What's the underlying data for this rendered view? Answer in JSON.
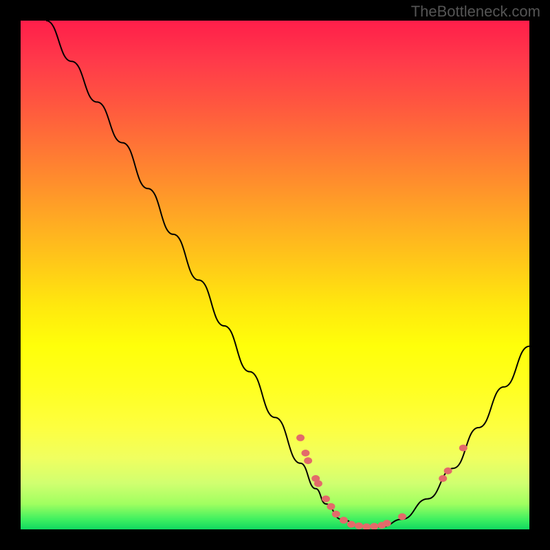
{
  "watermark": "TheBottleneck.com",
  "chart_data": {
    "type": "line",
    "title": "",
    "xlabel": "",
    "ylabel": "",
    "xlim": [
      0,
      100
    ],
    "ylim": [
      0,
      100
    ],
    "curve": {
      "description": "V-shaped bottleneck curve",
      "points": [
        {
          "x": 5,
          "y": 100
        },
        {
          "x": 10,
          "y": 92
        },
        {
          "x": 15,
          "y": 84
        },
        {
          "x": 20,
          "y": 76
        },
        {
          "x": 25,
          "y": 67
        },
        {
          "x": 30,
          "y": 58
        },
        {
          "x": 35,
          "y": 49
        },
        {
          "x": 40,
          "y": 40
        },
        {
          "x": 45,
          "y": 31
        },
        {
          "x": 50,
          "y": 22
        },
        {
          "x": 55,
          "y": 13
        },
        {
          "x": 58,
          "y": 8
        },
        {
          "x": 60,
          "y": 5
        },
        {
          "x": 63,
          "y": 2
        },
        {
          "x": 67,
          "y": 0.5
        },
        {
          "x": 71,
          "y": 0.5
        },
        {
          "x": 75,
          "y": 2
        },
        {
          "x": 80,
          "y": 6
        },
        {
          "x": 85,
          "y": 12
        },
        {
          "x": 90,
          "y": 20
        },
        {
          "x": 95,
          "y": 28
        },
        {
          "x": 100,
          "y": 36
        }
      ]
    },
    "highlighted_points": [
      {
        "x": 55,
        "y": 18
      },
      {
        "x": 56,
        "y": 15
      },
      {
        "x": 56.5,
        "y": 13.5
      },
      {
        "x": 58,
        "y": 10
      },
      {
        "x": 58.5,
        "y": 9
      },
      {
        "x": 60,
        "y": 6
      },
      {
        "x": 61,
        "y": 4.5
      },
      {
        "x": 62,
        "y": 3
      },
      {
        "x": 63.5,
        "y": 1.8
      },
      {
        "x": 65,
        "y": 1
      },
      {
        "x": 66.5,
        "y": 0.7
      },
      {
        "x": 68,
        "y": 0.5
      },
      {
        "x": 69.5,
        "y": 0.6
      },
      {
        "x": 71,
        "y": 0.8
      },
      {
        "x": 72,
        "y": 1.2
      },
      {
        "x": 75,
        "y": 2.5
      },
      {
        "x": 83,
        "y": 10
      },
      {
        "x": 84,
        "y": 11.5
      },
      {
        "x": 87,
        "y": 16
      }
    ]
  },
  "colors": {
    "background": "#000000",
    "gradient_top": "#ff1e4a",
    "gradient_bottom": "#10d860",
    "curve": "#000000",
    "points": "#e36a6a"
  }
}
